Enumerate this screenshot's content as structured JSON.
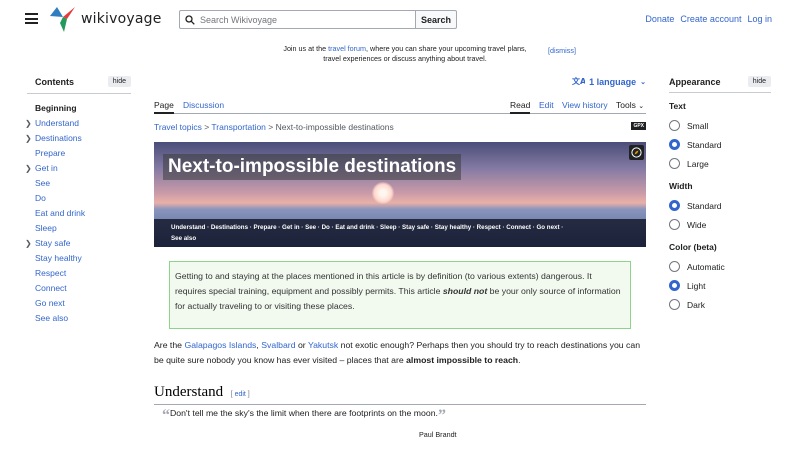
{
  "header": {
    "logo_text": "wikivoyage",
    "search_placeholder": "Search Wikivoyage",
    "search_button": "Search",
    "user_links": [
      "Donate",
      "Create account",
      "Log in"
    ]
  },
  "banner": {
    "line1_pre": "Join us at the ",
    "line1_link": "travel forum",
    "line1_post": ", where you can share your upcoming travel plans,",
    "line2": "travel experiences or discuss anything about travel.",
    "dismiss": "[dismiss]"
  },
  "toc": {
    "title": "Contents",
    "hide": "hide",
    "items": [
      {
        "label": "Beginning",
        "chevron": false
      },
      {
        "label": "Understand",
        "chevron": true
      },
      {
        "label": "Destinations",
        "chevron": true
      },
      {
        "label": "Prepare",
        "chevron": false
      },
      {
        "label": "Get in",
        "chevron": true
      },
      {
        "label": "See",
        "chevron": false
      },
      {
        "label": "Do",
        "chevron": false
      },
      {
        "label": "Eat and drink",
        "chevron": false
      },
      {
        "label": "Sleep",
        "chevron": false
      },
      {
        "label": "Stay safe",
        "chevron": true
      },
      {
        "label": "Stay healthy",
        "chevron": false
      },
      {
        "label": "Respect",
        "chevron": false
      },
      {
        "label": "Connect",
        "chevron": false
      },
      {
        "label": "Go next",
        "chevron": false
      },
      {
        "label": "See also",
        "chevron": false
      }
    ]
  },
  "main": {
    "language": "1 language",
    "tabs_left": [
      "Page",
      "Discussion"
    ],
    "tabs_right": [
      "Read",
      "Edit",
      "View history",
      "Tools"
    ],
    "breadcrumb": {
      "crumb1": "Travel topics",
      "sep": " > ",
      "crumb2": "Transportation",
      "current": "Next-to-impossible destinations"
    },
    "gpx": "GPX",
    "hero_title": "Next-to-impossible destinations",
    "hero_nav_line1": "Understand · Destinations · Prepare · Get in · See · Do · Eat and drink · Sleep · Stay safe · Stay healthy · Respect · Connect · Go next ·",
    "hero_nav_line2": "See also",
    "warning": {
      "pre": "Getting to and staying at the places mentioned in this article is by definition (to various extents) dangerous. It requires special training, equipment and possibly permits. This article ",
      "emph": "should not",
      "post": " be your only source of information for actually traveling to or visiting these places."
    },
    "intro": {
      "pre": "Are the ",
      "link1": "Galapagos Islands",
      "sep1": ", ",
      "link2": "Svalbard",
      "sep2": " or ",
      "link3": "Yakutsk",
      "mid": " not exotic enough? Perhaps then you should try to reach destinations you can be quite sure nobody you know has ever visited – places that are ",
      "bold": "almost impossible to reach",
      "post": "."
    },
    "section_title": "Understand",
    "section_edit": "edit",
    "quote": "Don't tell me the sky's the limit when there are footprints on the moon.",
    "quote_author": "Paul Brandt"
  },
  "appearance": {
    "title": "Appearance",
    "hide": "hide",
    "text_label": "Text",
    "text_options": [
      "Small",
      "Standard",
      "Large"
    ],
    "text_selected": "Standard",
    "width_label": "Width",
    "width_options": [
      "Standard",
      "Wide"
    ],
    "width_selected": "Standard",
    "color_label": "Color (beta)",
    "color_options": [
      "Automatic",
      "Light",
      "Dark"
    ],
    "color_selected": "Light"
  },
  "colors": {
    "link": "#3366cc",
    "warning_bg": "#f2faef",
    "warning_border": "#8ed38a",
    "radio_on": "#3366cc"
  }
}
